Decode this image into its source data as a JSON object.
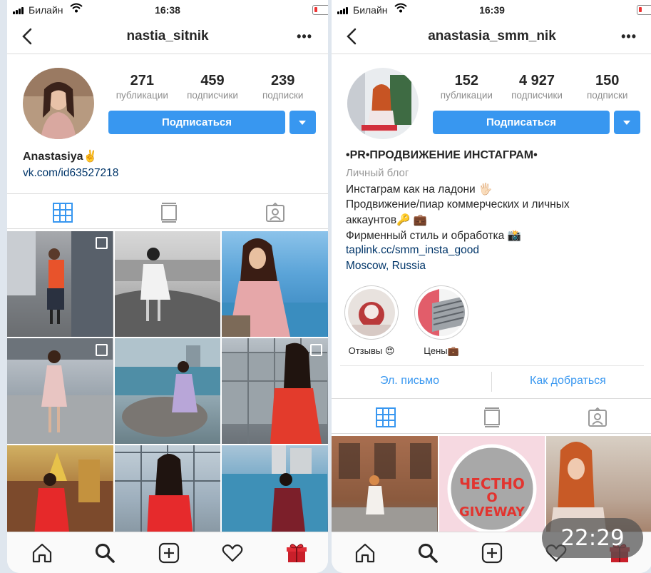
{
  "left": {
    "status": {
      "carrier": "Билайн",
      "time": "16:38"
    },
    "username": "nastia_sitnik",
    "stats": [
      {
        "value": "271",
        "label": "публикации"
      },
      {
        "value": "459",
        "label": "подписчики"
      },
      {
        "value": "239",
        "label": "подписки"
      }
    ],
    "follow_label": "Подписаться",
    "name": "Anastasiya✌️",
    "link": "vk.com/id63527218"
  },
  "right": {
    "status": {
      "carrier": "Билайн",
      "time": "16:39"
    },
    "username": "anastasia_smm_nik",
    "stats": [
      {
        "value": "152",
        "label": "публикации"
      },
      {
        "value": "4 927",
        "label": "подписчики"
      },
      {
        "value": "150",
        "label": "подписки"
      }
    ],
    "follow_label": "Подписаться",
    "name": "•PR•ПРОДВИЖЕНИЕ ИНСТАГРАМ•",
    "category": "Личный блог",
    "bio_lines": [
      "Инстаграм как на ладони 🖐🏻",
      "Продвижение/пиар коммерческих и личных",
      "аккаунтов🔑 💼",
      "Фирменный стиль и обработка 📸"
    ],
    "link": "taplink.cc/smm_insta_good",
    "location": "Moscow, Russia",
    "highlights": [
      {
        "label": "Отзывы 😍"
      },
      {
        "label": "Цены💼"
      }
    ],
    "contact": {
      "email": "Эл. письмо",
      "directions": "Как добраться"
    },
    "giveaway_text": [
      "ЧЕСТНО",
      "О",
      "GIVEWAY"
    ]
  },
  "overlay_time": "22:29",
  "colors": {
    "accent": "#3897f0",
    "link": "#003569"
  },
  "icons": [
    "back-icon",
    "more-icon",
    "grid-icon",
    "feed-icon",
    "tagged-icon",
    "home-icon",
    "search-icon",
    "add-icon",
    "heart-icon",
    "gift-icon"
  ]
}
